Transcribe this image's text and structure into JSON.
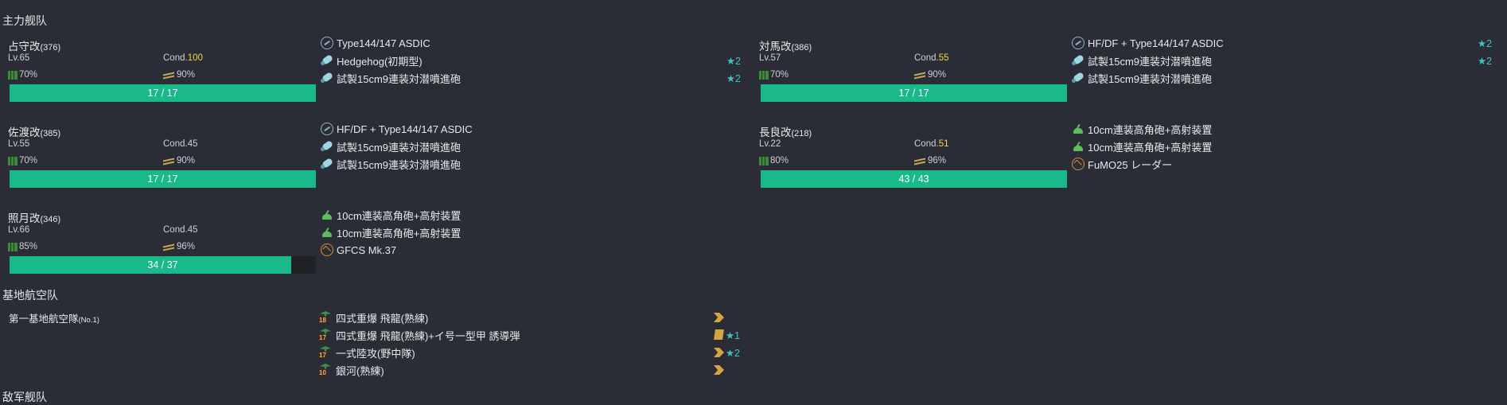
{
  "sections": {
    "main_fleet": "主力舰队",
    "land_base": "基地航空队",
    "enemy_fleet": "敌军舰队"
  },
  "ships": [
    {
      "name": "占守改",
      "id": "(376)",
      "lv": "Lv.65",
      "cond_label": "Cond.",
      "cond": "100",
      "cond_hi": true,
      "fuel": "70%",
      "ammo": "90%",
      "hp_text": "17 / 17",
      "hp_fraction": 1.0,
      "equipment": [
        {
          "icon": "sonar-icon",
          "name": "Type144/147 ASDIC",
          "star": ""
        },
        {
          "icon": "depth-charge-icon",
          "name": "Hedgehog(初期型)",
          "star": "★2"
        },
        {
          "icon": "depth-charge-icon",
          "name": "試製15cm9連装対潜噴進砲",
          "star": "★2"
        }
      ]
    },
    {
      "name": "対馬改",
      "id": "(386)",
      "lv": "Lv.57",
      "cond_label": "Cond.",
      "cond": "55",
      "cond_hi": true,
      "fuel": "70%",
      "ammo": "90%",
      "hp_text": "17 / 17",
      "hp_fraction": 1.0,
      "equipment": [
        {
          "icon": "sonar-icon",
          "name": "HF/DF + Type144/147 ASDIC",
          "star": "★2"
        },
        {
          "icon": "depth-charge-icon",
          "name": "試製15cm9連装対潜噴進砲",
          "star": "★2"
        },
        {
          "icon": "depth-charge-icon",
          "name": "試製15cm9連装対潜噴進砲",
          "star": ""
        }
      ]
    },
    {
      "name": "佐渡改",
      "id": "(385)",
      "lv": "Lv.55",
      "cond_label": "Cond.",
      "cond": "45",
      "cond_hi": false,
      "fuel": "70%",
      "ammo": "90%",
      "hp_text": "17 / 17",
      "hp_fraction": 1.0,
      "equipment": [
        {
          "icon": "sonar-icon",
          "name": "HF/DF + Type144/147 ASDIC",
          "star": ""
        },
        {
          "icon": "depth-charge-icon",
          "name": "試製15cm9連装対潜噴進砲",
          "star": ""
        },
        {
          "icon": "depth-charge-icon",
          "name": "試製15cm9連装対潜噴進砲",
          "star": ""
        }
      ]
    },
    {
      "name": "長良改",
      "id": "(218)",
      "lv": "Lv.22",
      "cond_label": "Cond.",
      "cond": "51",
      "cond_hi": true,
      "fuel": "80%",
      "ammo": "96%",
      "hp_text": "43 / 43",
      "hp_fraction": 1.0,
      "equipment": [
        {
          "icon": "hi-angle-gun-icon",
          "name": "10cm連装高角砲+高射装置",
          "star": ""
        },
        {
          "icon": "hi-angle-gun-icon",
          "name": "10cm連装高角砲+高射装置",
          "star": ""
        },
        {
          "icon": "radar-icon",
          "name": "FuMO25 レーダー",
          "star": ""
        }
      ]
    },
    {
      "name": "照月改",
      "id": "(346)",
      "lv": "Lv.66",
      "cond_label": "Cond.",
      "cond": "45",
      "cond_hi": false,
      "fuel": "85%",
      "ammo": "96%",
      "hp_text": "34 / 37",
      "hp_fraction": 0.919,
      "equipment": [
        {
          "icon": "hi-angle-gun-icon",
          "name": "10cm連装高角砲+高射装置",
          "star": ""
        },
        {
          "icon": "hi-angle-gun-icon",
          "name": "10cm連装高角砲+高射装置",
          "star": ""
        },
        {
          "icon": "radar-icon",
          "name": "GFCS Mk.37",
          "star": ""
        }
      ]
    }
  ],
  "land_base": {
    "name": "第一基地航空隊",
    "number": "(No.1)",
    "planes": [
      {
        "icon": "land-bomber-icon",
        "count": "18",
        "name": "四式重爆 飛龍(熟練)",
        "proficiency": "chevron-double-icon",
        "star": ""
      },
      {
        "icon": "land-bomber-icon",
        "count": "17",
        "name": "四式重爆 飛龍(熟練)+イ号一型甲 誘導弾",
        "proficiency": "flag-icon",
        "star": "★1"
      },
      {
        "icon": "land-bomber-icon",
        "count": "17",
        "name": "一式陸攻(野中隊)",
        "proficiency": "chevron-double-icon",
        "star": "★2"
      },
      {
        "icon": "land-bomber-icon",
        "count": "10",
        "name": "銀河(熟練)",
        "proficiency": "chevron-double-icon",
        "star": ""
      }
    ]
  }
}
